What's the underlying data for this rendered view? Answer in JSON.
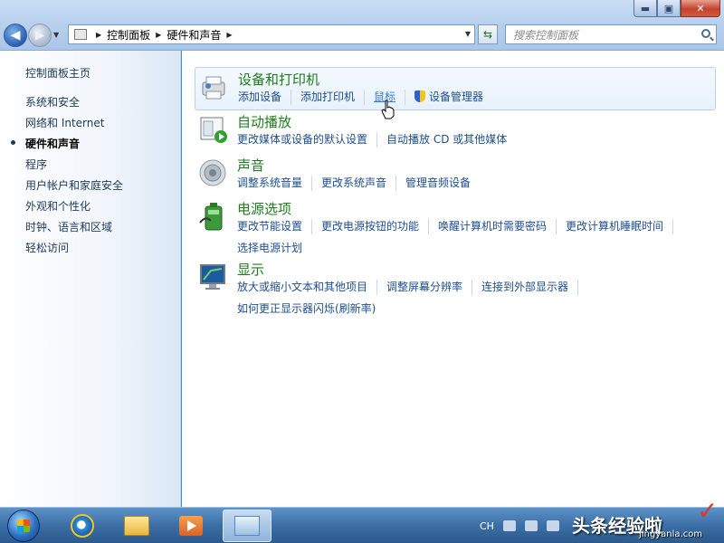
{
  "window": {
    "controls": {
      "minimize": "▬",
      "maximize": "▣",
      "close": "✕"
    }
  },
  "navbar": {
    "back_icon": "back-arrow-icon",
    "forward_icon": "forward-arrow-icon",
    "breadcrumb": [
      "控制面板",
      "硬件和声音"
    ],
    "search_placeholder": "搜索控制面板"
  },
  "sidebar": {
    "home": "控制面板主页",
    "items": [
      {
        "label": "系统和安全",
        "active": false
      },
      {
        "label": "网络和 Internet",
        "active": false
      },
      {
        "label": "硬件和声音",
        "active": true
      },
      {
        "label": "程序",
        "active": false
      },
      {
        "label": "用户帐户和家庭安全",
        "active": false
      },
      {
        "label": "外观和个性化",
        "active": false
      },
      {
        "label": "时钟、语言和区域",
        "active": false
      },
      {
        "label": "轻松访问",
        "active": false
      }
    ]
  },
  "categories": [
    {
      "title": "设备和打印机",
      "icon": "printer-icon",
      "links": [
        "添加设备",
        "添加打印机",
        "鼠标",
        "设备管理器"
      ]
    },
    {
      "title": "自动播放",
      "icon": "autoplay-icon",
      "links": [
        "更改媒体或设备的默认设置",
        "自动播放 CD 或其他媒体"
      ]
    },
    {
      "title": "声音",
      "icon": "speaker-icon",
      "links": [
        "调整系统音量",
        "更改系统声音",
        "管理音频设备"
      ]
    },
    {
      "title": "电源选项",
      "icon": "battery-icon",
      "links": [
        "更改节能设置",
        "更改电源按钮的功能",
        "唤醒计算机时需要密码",
        "更改计算机睡眠时间",
        "选择电源计划"
      ]
    },
    {
      "title": "显示",
      "icon": "monitor-icon",
      "links": [
        "放大或缩小文本和其他项目",
        "调整屏幕分辨率",
        "连接到外部显示器",
        "如何更正显示器闪烁(刷新率)"
      ]
    }
  ],
  "taskbar": {
    "pinned": [
      "internet-explorer",
      "windows-explorer",
      "media-player",
      "control-panel"
    ],
    "tray_lang": "CH",
    "watermark": "头条经验啦",
    "watermark_sub": "jingyanla.com"
  },
  "colors": {
    "link": "#1e4f8c",
    "category_title": "#1e7c1e",
    "sidebar_text": "#1e395b",
    "taskbar": "#3b6fa6"
  }
}
